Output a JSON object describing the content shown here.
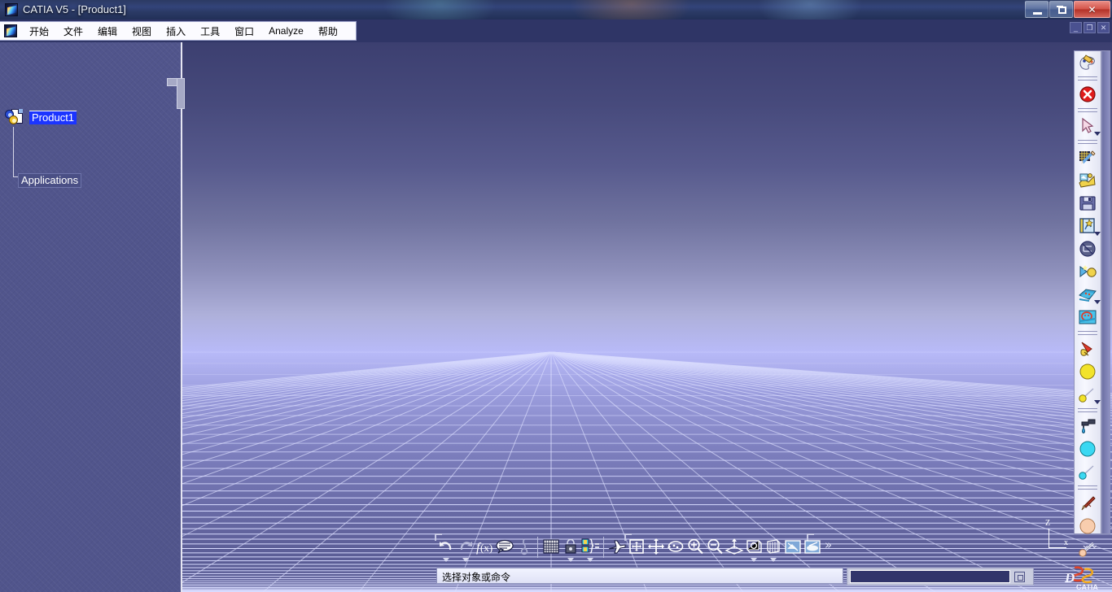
{
  "window": {
    "title": "CATIA V5 - [Product1]",
    "app_icon": "catia-logo-icon",
    "buttons": {
      "minimize": "minimize-icon",
      "maximize": "maximize-icon",
      "close": "✕"
    },
    "mdi_buttons": {
      "minimize": "_",
      "restore": "❐",
      "close": "✕"
    }
  },
  "menubar": {
    "icon": "catia-logo-icon",
    "items": [
      {
        "label": "开始"
      },
      {
        "label": "文件"
      },
      {
        "label": "编辑"
      },
      {
        "label": "视图"
      },
      {
        "label": "插入"
      },
      {
        "label": "工具"
      },
      {
        "label": "窗口"
      },
      {
        "label": "Analyze"
      },
      {
        "label": "帮助"
      }
    ]
  },
  "tree": {
    "root": {
      "label": "Product1",
      "selected": true,
      "icon": "product-gears-icon"
    },
    "child": {
      "label": "Applications",
      "icon": "applications-node"
    }
  },
  "viewport": {
    "axis": {
      "z": "Z",
      "x": "x"
    },
    "colors": {
      "sky_top": "#3c3f70",
      "horizon": "#b8baf8",
      "ground_bottom": "#55578f",
      "grid_line": "#ccd0ff"
    }
  },
  "bottom_toolbar": {
    "groups": [
      {
        "name": "standard",
        "items": [
          {
            "name": "undo-icon",
            "label": "撤销",
            "has_arrow": true
          },
          {
            "name": "redo-icon",
            "label": "重做",
            "has_arrow": true
          },
          {
            "name": "formula-fx-icon",
            "label": "f(x)",
            "has_arrow": false
          },
          {
            "name": "comment-balloon-icon",
            "label": "注释",
            "has_arrow": false
          },
          {
            "name": "knot-icon",
            "label": "结点",
            "has_arrow": false
          }
        ]
      },
      {
        "name": "tools",
        "items": [
          {
            "name": "grid-table-icon",
            "label": "网格",
            "has_arrow": false
          },
          {
            "name": "lock-padlock-icon",
            "label": "锁定",
            "has_arrow": true
          },
          {
            "name": "parameters-icon",
            "label": "参数",
            "has_arrow": true
          }
        ]
      },
      {
        "name": "view",
        "items": [
          {
            "name": "fly-mode-icon",
            "label": "飞行模式",
            "has_arrow": false
          },
          {
            "name": "fit-all-in-icon",
            "label": "全部适应",
            "has_arrow": false
          },
          {
            "name": "pan-icon",
            "label": "平移",
            "has_arrow": false
          },
          {
            "name": "rotate-icon",
            "label": "旋转",
            "has_arrow": false
          },
          {
            "name": "zoom-in-icon",
            "label": "放大",
            "has_arrow": false
          },
          {
            "name": "zoom-out-icon",
            "label": "缩小",
            "has_arrow": false
          },
          {
            "name": "normal-view-icon",
            "label": "法线视图",
            "has_arrow": false
          },
          {
            "name": "named-views-icon",
            "label": "已命名视图",
            "has_arrow": true
          },
          {
            "name": "render-style-icon",
            "label": "渲染样式",
            "has_arrow": true
          },
          {
            "name": "apply-material-icon",
            "label": "应用材料",
            "has_arrow": false
          },
          {
            "name": "hide-show-icon",
            "label": "隐藏/显示",
            "has_arrow": false
          }
        ]
      }
    ],
    "overflow": "»"
  },
  "statusbar": {
    "message": "选择对象或命令",
    "command_input_value": "",
    "command_input_placeholder": "",
    "command_button": "dialog-box-icon",
    "brand": "DS CATIA"
  },
  "right_toolbar": {
    "items": [
      {
        "name": "workbench-palette-icon",
        "label": "工作台"
      },
      {
        "separator": true
      },
      {
        "name": "cancel-red-x-icon",
        "label": "取消"
      },
      {
        "separator": true
      },
      {
        "name": "select-arrow-icon",
        "label": "选择",
        "has_arrow": true
      },
      {
        "separator": true
      },
      {
        "name": "sketch-pencil-icon",
        "label": "草图"
      },
      {
        "name": "product-structure-icon",
        "label": "产品结构"
      },
      {
        "name": "save-floppy-icon",
        "label": "保存"
      },
      {
        "name": "catalog-browser-icon",
        "label": "目录浏览器",
        "has_arrow": true
      },
      {
        "name": "measure-icon",
        "label": "测量"
      },
      {
        "name": "constraints-icon",
        "label": "约束"
      },
      {
        "name": "surface-icon",
        "label": "曲面",
        "has_arrow": true
      },
      {
        "name": "annotation-icon",
        "label": "注释"
      },
      {
        "separator": true
      },
      {
        "name": "light-source-icon",
        "label": "光源"
      },
      {
        "name": "sphere-yellow-icon",
        "label": "球体"
      },
      {
        "name": "point-yellow-icon",
        "label": "点",
        "has_arrow": true
      },
      {
        "separator": true
      },
      {
        "name": "material-dropper-icon",
        "label": "材料"
      },
      {
        "name": "sphere-cyan-icon",
        "label": "青色球体"
      },
      {
        "name": "point-cyan-icon",
        "label": "青色点"
      },
      {
        "separator": true
      },
      {
        "name": "paint-pen-icon",
        "label": "画笔"
      },
      {
        "name": "sphere-peach-icon",
        "label": "桃色球体"
      },
      {
        "name": "point-peach-icon",
        "label": "桃色点"
      }
    ],
    "overflow": "⌄⌄"
  }
}
